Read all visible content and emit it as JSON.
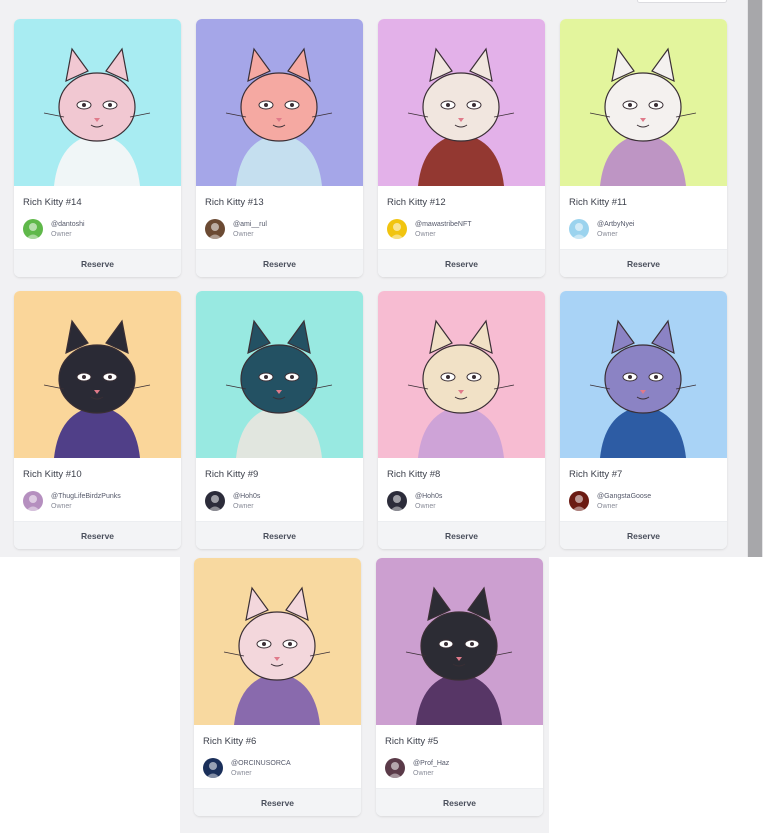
{
  "cards": [
    {
      "title": "Rich Kitty #14",
      "handle": "@dantoshi",
      "role": "Owner",
      "button": "Reserve",
      "bg": "#a8ecf2",
      "fur": "#f1c8d2",
      "accent": "#f7f7f7",
      "avatar": "#5fb84a"
    },
    {
      "title": "Rich Kitty #13",
      "handle": "@ami__rul",
      "role": "Owner",
      "button": "Reserve",
      "bg": "#a5a6e8",
      "fur": "#f5a9a2",
      "accent": "#c9e5ef",
      "avatar": "#6b4a33"
    },
    {
      "title": "Rich Kitty #12",
      "handle": "@mawastribeNFT",
      "role": "Owner",
      "button": "Reserve",
      "bg": "#e3b1e9",
      "fur": "#f1e6df",
      "accent": "#8a2b1d",
      "avatar": "#f1c40f"
    },
    {
      "title": "Rich Kitty #11",
      "handle": "@ArtbyNyei",
      "role": "Owner",
      "button": "Reserve",
      "bg": "#e3f59d",
      "fur": "#f4f1ef",
      "accent": "#b98bc9",
      "avatar": "#9bd3ee"
    },
    {
      "title": "Rich Kitty #10",
      "handle": "@ThugLifeBirdzPunks",
      "role": "Owner",
      "button": "Reserve",
      "bg": "#fad69a",
      "fur": "#2a2a35",
      "accent": "#3d2f86",
      "avatar": "#b58fbf"
    },
    {
      "title": "Rich Kitty #9",
      "handle": "@Hoh0s",
      "role": "Owner",
      "button": "Reserve",
      "bg": "#98e9e1",
      "fur": "#235163",
      "accent": "#e9e6df",
      "avatar": "#2c2c3a"
    },
    {
      "title": "Rich Kitty #8",
      "handle": "@Hoh0s",
      "role": "Owner",
      "button": "Reserve",
      "bg": "#f7bcd2",
      "fur": "#f1e1c6",
      "accent": "#c9a0d7",
      "avatar": "#2c2c3a"
    },
    {
      "title": "Rich Kitty #7",
      "handle": "@GangstaGoose",
      "role": "Owner",
      "button": "Reserve",
      "bg": "#a9d3f6",
      "fur": "#8b83c4",
      "accent": "#1f4f9b",
      "avatar": "#6b1b13"
    },
    {
      "title": "Rich Kitty #6",
      "handle": "@ORCINUSORCA",
      "role": "Owner",
      "button": "Reserve",
      "bg": "#f8d9a0",
      "fur": "#f3d7dc",
      "accent": "#7c5dae",
      "avatar": "#1a2f5a"
    },
    {
      "title": "Rich Kitty #5",
      "handle": "@Prof_Haz",
      "role": "Owner",
      "button": "Reserve",
      "bg": "#cc9fd0",
      "fur": "#2c2c34",
      "accent": "#4a2a5a",
      "avatar": "#5a3a48"
    }
  ]
}
